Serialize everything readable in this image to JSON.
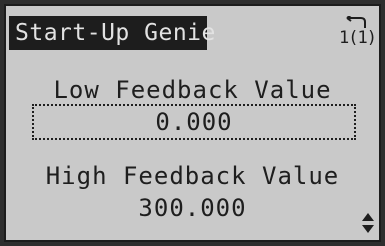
{
  "header": {
    "title": "Start-Up Genie",
    "page_indicator": "1(1)",
    "back_icon": "return-arrow-icon"
  },
  "parameters": [
    {
      "label": "Low Feedback Value",
      "value": "0.000",
      "selected": true
    },
    {
      "label": "High Feedback Value",
      "value": "300.000",
      "selected": false
    }
  ],
  "footer": {
    "scroll_icon": "up-down-arrows-icon"
  },
  "colors": {
    "screen_bg": "#c9c9c9",
    "title_bg": "#1d1d1d",
    "title_text": "#e2e2e2",
    "text": "#1e1e1e",
    "bezel": "#2e2e2e"
  }
}
